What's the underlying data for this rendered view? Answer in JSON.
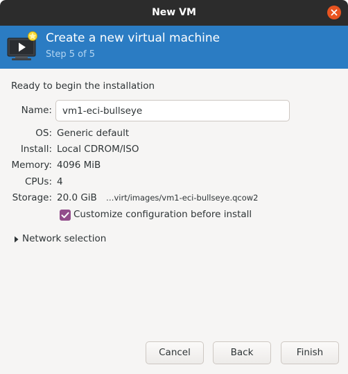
{
  "window": {
    "title": "New VM"
  },
  "banner": {
    "title": "Create a new virtual machine",
    "step": "Step 5 of 5"
  },
  "summary": {
    "heading": "Ready to begin the installation",
    "name_label": "Name:",
    "name_value": "vm1-eci-bullseye",
    "os_label": "OS:",
    "os_value": "Generic default",
    "install_label": "Install:",
    "install_value": "Local CDROM/ISO",
    "memory_label": "Memory:",
    "memory_value": "4096 MiB",
    "cpus_label": "CPUs:",
    "cpus_value": "4",
    "storage_label": "Storage:",
    "storage_size": "20.0 GiB",
    "storage_path": "…virt/images/vm1-eci-bullseye.qcow2"
  },
  "customize": {
    "label": "Customize configuration before install",
    "checked": true
  },
  "network": {
    "label": "Network selection",
    "expanded": false
  },
  "buttons": {
    "cancel": "Cancel",
    "back": "Back",
    "finish": "Finish"
  },
  "colors": {
    "titlebar": "#2c2c2c",
    "banner": "#2b7cc3",
    "close_button": "#e95420",
    "checkbox": "#924d8b",
    "background": "#f6f5f4"
  },
  "icons": {
    "close": "close-icon",
    "banner": "new-vm-monitor-icon",
    "checkbox": "checkmark-icon",
    "expander": "triangle-right-icon"
  }
}
